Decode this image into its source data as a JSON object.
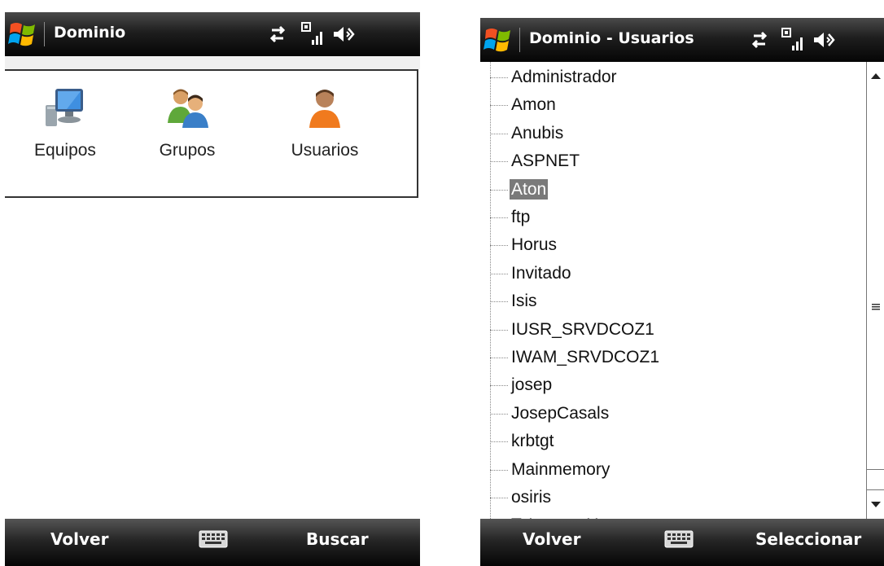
{
  "left_screen": {
    "title": "Dominio",
    "items": [
      {
        "label": "Equipos",
        "icon": "computer-icon"
      },
      {
        "label": "Grupos",
        "icon": "group-icon"
      },
      {
        "label": "Usuarios",
        "icon": "user-icon"
      }
    ],
    "softkeys": {
      "left": "Volver",
      "right": "Buscar"
    }
  },
  "right_screen": {
    "title": "Dominio - Usuarios",
    "selected_index": 4,
    "users": [
      "Administrador",
      "Amon",
      "Anubis",
      "ASPNET",
      "Aton",
      "ftp",
      "Horus",
      "Invitado",
      "Isis",
      "IUSR_SRVDCOZ1",
      "IWAM_SRVDCOZ1",
      "josep",
      "JosepCasals",
      "krbtgt",
      "Mainmemory",
      "osiris",
      "TsInternetUser"
    ],
    "softkeys": {
      "left": "Volver",
      "right": "Seleccionar"
    }
  },
  "colors": {
    "titlebar": "#1e1e1e",
    "selection": "#7a7a7a",
    "launcher_border": "#333333"
  }
}
